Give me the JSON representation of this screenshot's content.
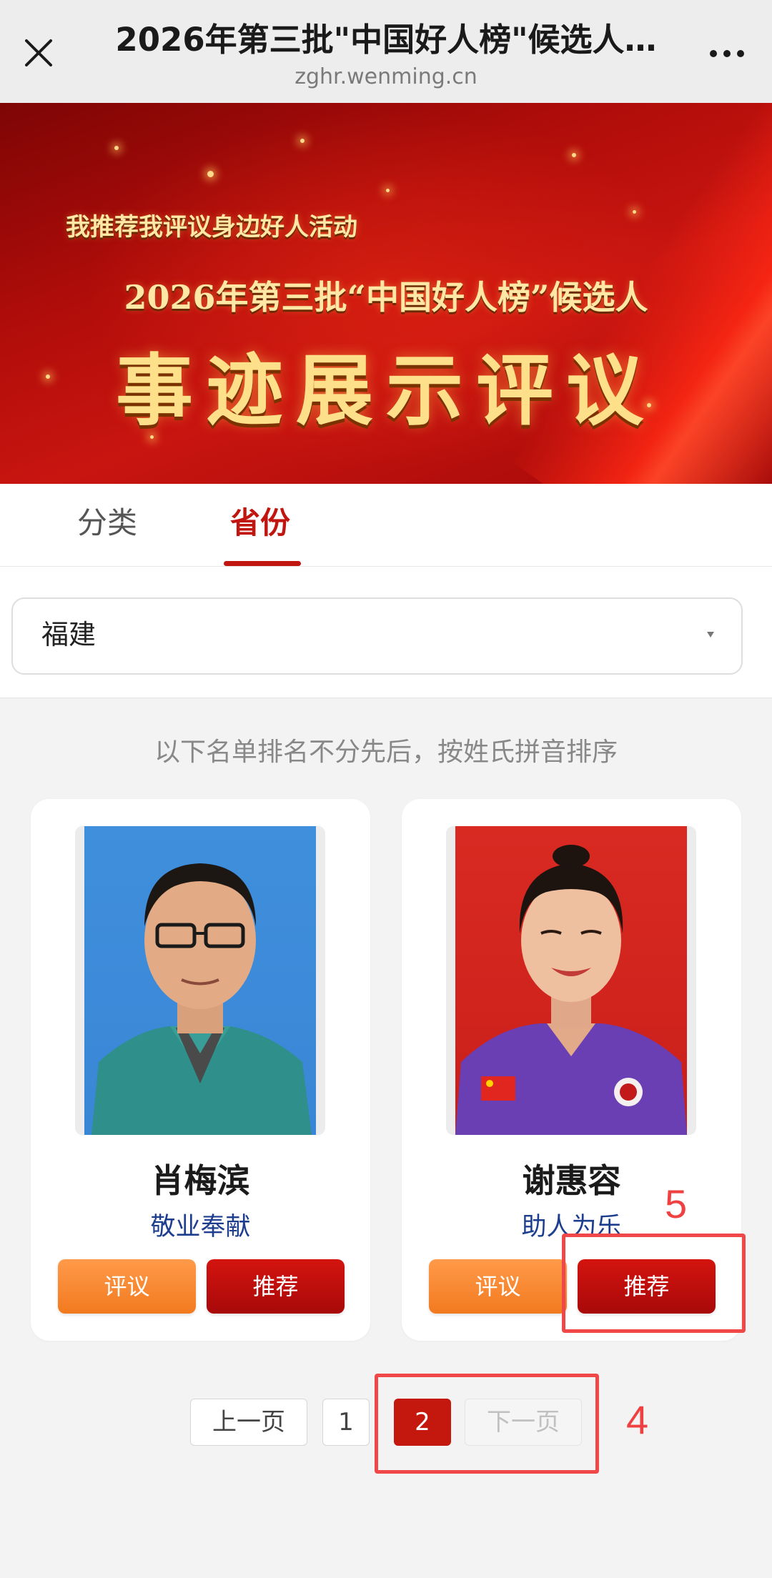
{
  "topbar": {
    "title": "2026年第三批\"中国好人榜\"候选人…",
    "url": "zghr.wenming.cn",
    "close_icon": "close-icon",
    "more_icon": "more-dots-icon"
  },
  "banner": {
    "subtitle": "我推荐我评议身边好人活动",
    "headline": "2026年第三批“中国好人榜”候选人",
    "big_title": "事迹展示评议",
    "accent_color": "#c91510",
    "text_color": "#ffe7a6"
  },
  "tabs": [
    {
      "label": "分类",
      "active": false
    },
    {
      "label": "省份",
      "active": true
    }
  ],
  "filter": {
    "selected_province": "福建",
    "arrow_icon": "caret-down-icon"
  },
  "notice": "以下名单排名不分先后，按姓氏拼音排序",
  "candidates": [
    {
      "name": "肖梅滨",
      "category": "敬业奉献",
      "comment_label": "评议",
      "recommend_label": "推荐"
    },
    {
      "name": "谢惠容",
      "category": "助人为乐",
      "comment_label": "评议",
      "recommend_label": "推荐"
    }
  ],
  "pagination": {
    "prev_label": "上一页",
    "pages": [
      "1",
      "2"
    ],
    "current_page": "2",
    "next_label": "下一页"
  },
  "annotations": {
    "recommend_marker": "5",
    "pagination_marker": "4",
    "color": "#f04848"
  },
  "colors": {
    "brand_red": "#c0160f",
    "comment_orange": "#f27a1f",
    "category_blue": "#1d3e8f"
  }
}
